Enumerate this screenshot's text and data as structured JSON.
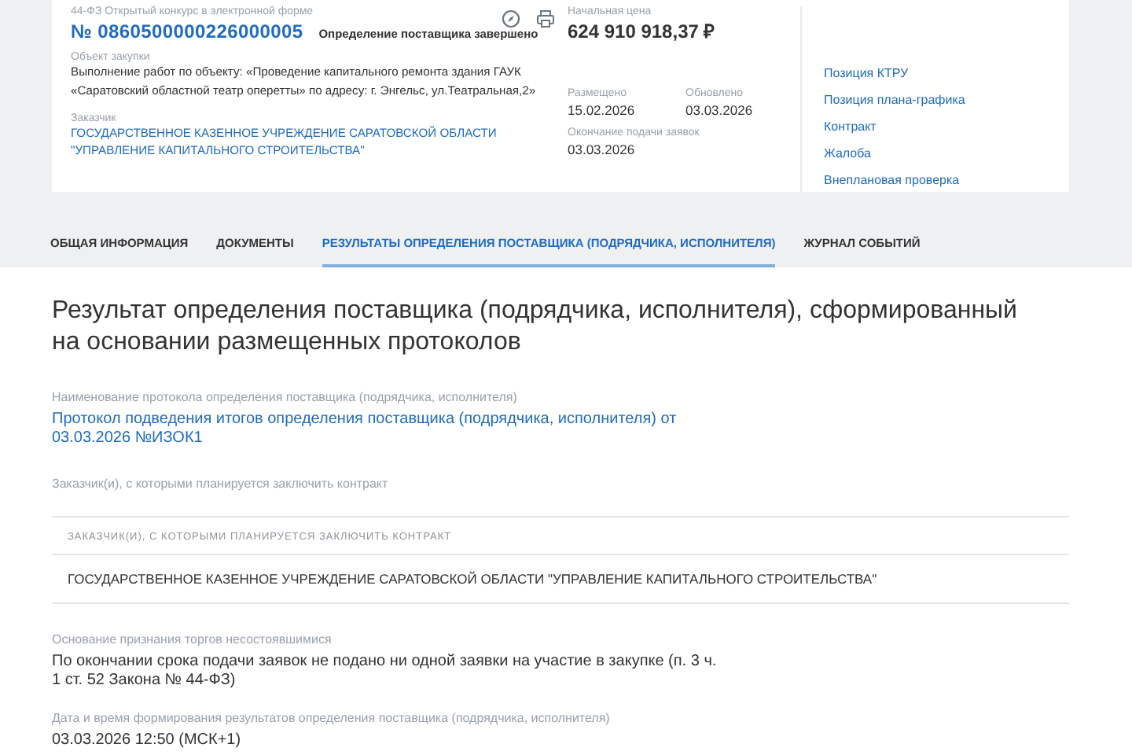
{
  "header": {
    "law_type": "44-ФЗ Открытый конкурс в электронной форме",
    "number": "№ 0860500000226000005",
    "status": "Определение поставщика завершено",
    "object_label": "Объект закупки",
    "object_text": "Выполнение работ по объекту: «Проведение капитального ремонта здания ГАУК «Саратовский областной театр оперетты» по адресу: г. Энгельс, ул.Театральная,2»",
    "customer_label": "Заказчик",
    "customer_name": "ГОСУДАРСТВЕННОЕ КАЗЕННОЕ УЧРЕЖДЕНИЕ САРАТОВСКОЙ ОБЛАСТИ \"УПРАВЛЕНИЕ КАПИТАЛЬНОГО СТРОИТЕЛЬСТВА\"",
    "price_label": "Начальная цена",
    "price": "624 910 918,37 ₽",
    "dates": [
      {
        "label": "Размещено",
        "value": "15.02.2026"
      },
      {
        "label": "Обновлено",
        "value": "03.03.2026"
      },
      {
        "label": "Окончание подачи заявок",
        "value": "03.03.2026"
      }
    ],
    "links": [
      "Позиция КТРУ",
      "Позиция плана-графика",
      "Контракт",
      "Жалоба",
      "Внеплановая проверка"
    ]
  },
  "tabs": [
    {
      "label": "ОБЩАЯ ИНФОРМАЦИЯ",
      "selected": false
    },
    {
      "label": "ДОКУМЕНТЫ",
      "selected": false
    },
    {
      "label": "РЕЗУЛЬТАТЫ ОПРЕДЕЛЕНИЯ ПОСТАВЩИКА (ПОДРЯДЧИКА, ИСПОЛНИТЕЛЯ)",
      "selected": true
    },
    {
      "label": "ЖУРНАЛ СОБЫТИЙ",
      "selected": false
    }
  ],
  "result": {
    "title": "Результат определения поставщика (подрядчика, исполнителя), сформированный на основании размещенных протоколов",
    "protocol_label": "Наименование протокола определения поставщика (подрядчика, исполнителя)",
    "protocol_link": "Протокол подведения итогов определения поставщика (подрядчика, исполнителя) от 03.03.2026 №ИЗОК1",
    "customers_label": "Заказчик(и), с которыми планируется заключить контракт",
    "table": {
      "column": "ЗАКАЗЧИК(И), С КОТОРЫМИ ПЛАНИРУЕТСЯ ЗАКЛЮЧИТЬ КОНТРАКТ",
      "rows": [
        "ГОСУДАРСТВЕННОЕ КАЗЕННОЕ УЧРЕЖДЕНИЕ САРАТОВСКОЙ ОБЛАСТИ \"УПРАВЛЕНИЕ КАПИТАЛЬНОГО СТРОИТЕЛЬСТВА\""
      ]
    },
    "reason_label": "Основание признания торгов несостоявшимися",
    "reason": "По окончании срока подачи заявок не подано ни одной заявки на участие в закупке (п. 3 ч. 1 ст. 52 Закона № 44-ФЗ)",
    "datetime_label": "Дата и время формирования результатов определения поставщика (подрядчика, исполнителя)",
    "datetime": "03.03.2026 12:50 (МСК+1)"
  }
}
